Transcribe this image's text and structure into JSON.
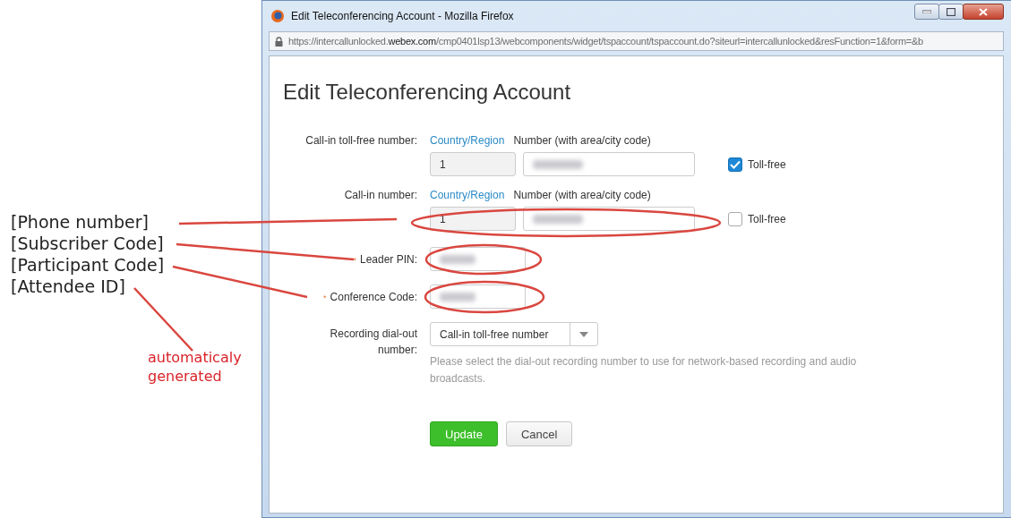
{
  "window": {
    "title": "Edit Teleconferencing Account - Mozilla Firefox",
    "url": {
      "prefix": "https://intercallunlocked.",
      "domain": "webex.com",
      "path": "/cmp0401lsp13/webcomponents/widget/tspaccount/tspaccount.do?siteurl=intercallunlocked&resFunction=1&form=&b"
    }
  },
  "heading": "Edit Teleconferencing Account",
  "phone_rows": [
    {
      "label": "Call-in toll-free number:",
      "country_link": "Country/Region",
      "number_heading": "Number (with area/city code)",
      "country_code": "1",
      "toll_free": {
        "label": "Toll-free",
        "checked": true
      }
    },
    {
      "label": "Call-in number:",
      "country_link": "Country/Region",
      "number_heading": "Number (with area/city code)",
      "country_code": "1",
      "toll_free": {
        "label": "Toll-free",
        "checked": false
      }
    }
  ],
  "code_fields": [
    {
      "label": "Leader PIN:",
      "required_mark": "*"
    },
    {
      "label": "Conference Code:",
      "required_mark": "*"
    }
  ],
  "recording": {
    "label": "Recording dial-out number:",
    "value": "Call-in toll-free number",
    "help": "Please select the dial-out recording number to use for network-based recording and audio broadcasts."
  },
  "buttons": [
    {
      "label": "Update",
      "kind": "primary"
    },
    {
      "label": "Cancel",
      "kind": "secondary"
    }
  ],
  "annotations": {
    "labels": [
      "[Phone number]",
      "[Subscriber Code]",
      "[Participant Code]",
      "[Attendee ID]"
    ],
    "note": "automaticaly generated"
  }
}
